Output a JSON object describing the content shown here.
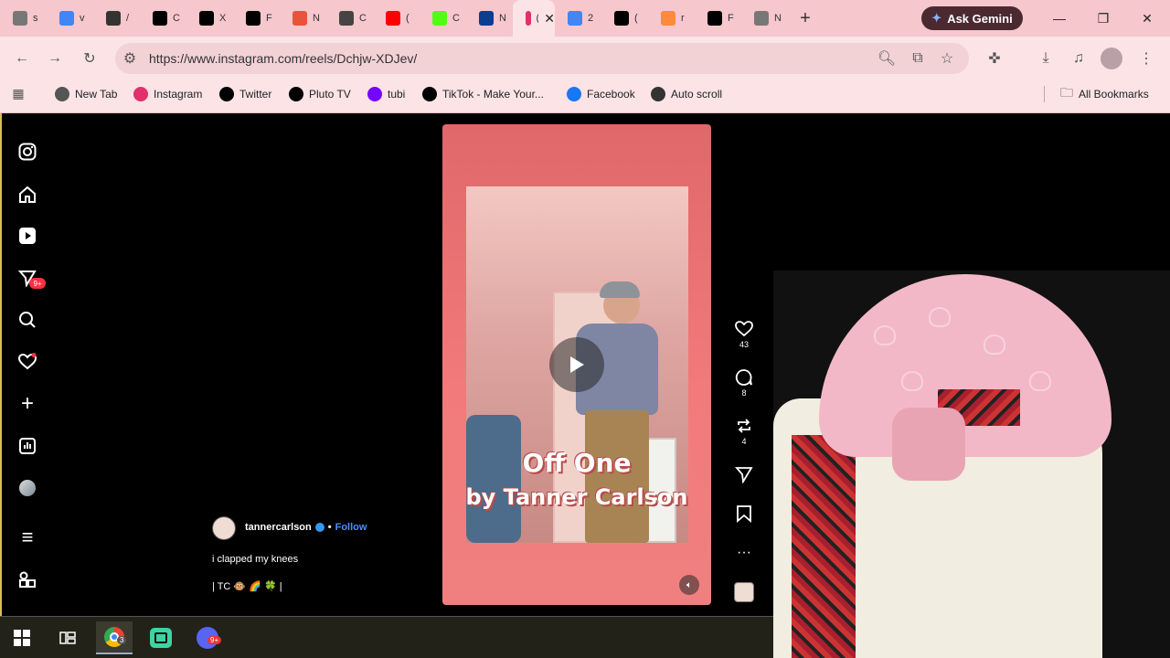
{
  "browser": {
    "tabs": [
      {
        "title": "s",
        "icon": "chrome-settings-icon",
        "color": "#777777"
      },
      {
        "title": "v",
        "icon": "google-icon",
        "color": "#4285f4"
      },
      {
        "title": "/",
        "icon": "app-icon",
        "color": "#333333"
      },
      {
        "title": "C",
        "icon": "tiktok-icon",
        "color": "#000000"
      },
      {
        "title": "X",
        "icon": "x-icon",
        "color": "#000000"
      },
      {
        "title": "F",
        "icon": "x-icon",
        "color": "#000000"
      },
      {
        "title": "N",
        "icon": "ars-icon",
        "color": "#e8543a"
      },
      {
        "title": "C",
        "icon": "calculator-icon",
        "color": "#444444"
      },
      {
        "title": "(",
        "icon": "youtube-icon",
        "color": "#ff0000"
      },
      {
        "title": "C",
        "icon": "kick-icon",
        "color": "#53fc18"
      },
      {
        "title": "N",
        "icon": "nasa-icon",
        "color": "#0b3d91"
      },
      {
        "title": "(",
        "icon": "instagram-icon",
        "color": "#e1306c",
        "active": true
      },
      {
        "title": "2",
        "icon": "google-icon",
        "color": "#4285f4"
      },
      {
        "title": "(",
        "icon": "x-icon",
        "color": "#000000"
      },
      {
        "title": "r",
        "icon": "reddit-icon",
        "color": "#ff8a3d"
      },
      {
        "title": "F",
        "icon": "tiktok-icon",
        "color": "#000000"
      },
      {
        "title": "N",
        "icon": "chrome-icon",
        "color": "#777777"
      }
    ],
    "ask_gemini": "Ask Gemini",
    "url": "https://www.instagram.com/reels/Dchjw-XDJev/",
    "bookmarks": [
      {
        "label": "New Tab",
        "icon": "chrome-icon",
        "color": "#555555"
      },
      {
        "label": "Instagram",
        "icon": "instagram-icon",
        "color": "#e1306c"
      },
      {
        "label": "Twitter",
        "icon": "x-icon",
        "color": "#000000"
      },
      {
        "label": "Pluto TV",
        "icon": "plutotv-icon",
        "color": "#000000"
      },
      {
        "label": "tubi",
        "icon": "tubi-icon",
        "color": "#7408ff"
      },
      {
        "label": "TikTok - Make Your...",
        "icon": "tiktok-icon",
        "color": "#000000"
      },
      {
        "label": "Facebook",
        "icon": "facebook-icon",
        "color": "#1877f2"
      },
      {
        "label": "Auto scroll",
        "icon": "autoscroll-icon",
        "color": "#333333"
      }
    ],
    "all_bookmarks": "All Bookmarks"
  },
  "sidebar": {
    "notification_badge": "9+"
  },
  "reel": {
    "overlay_line1": "Off One",
    "overlay_line2": "by Tanner Carlson",
    "likes": "43",
    "comments": "8",
    "reposts": "4",
    "username": "tannercarlson",
    "follow": "Follow",
    "separator": "•",
    "caption": "i clapped my knees",
    "caption2": "| TC 🐵 🌈 🍀 |"
  },
  "taskbar": {
    "chrome_badge": "3",
    "discord_badge": "9+"
  }
}
